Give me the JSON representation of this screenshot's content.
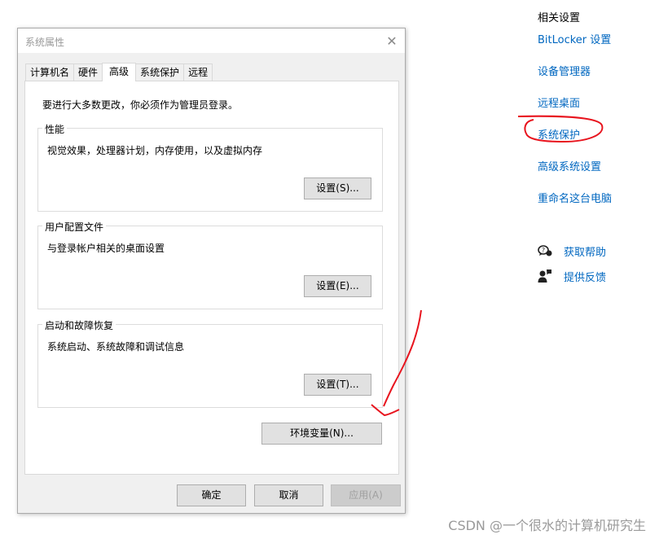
{
  "dialog": {
    "title": "系统属性",
    "tabs": [
      {
        "label": "计算机名",
        "active": false
      },
      {
        "label": "硬件",
        "active": false
      },
      {
        "label": "高级",
        "active": true
      },
      {
        "label": "系统保护",
        "active": false
      },
      {
        "label": "远程",
        "active": false
      }
    ],
    "intro": "要进行大多数更改，你必须作为管理员登录。",
    "groups": {
      "performance": {
        "title": "性能",
        "description": "视觉效果，处理器计划，内存使用，以及虚拟内存",
        "button": "设置(S)..."
      },
      "user_profiles": {
        "title": "用户配置文件",
        "description": "与登录帐户相关的桌面设置",
        "button": "设置(E)..."
      },
      "startup_recovery": {
        "title": "启动和故障恢复",
        "description": "系统启动、系统故障和调试信息",
        "button": "设置(T)..."
      }
    },
    "env_button": "环境变量(N)...",
    "footer": {
      "ok": "确定",
      "cancel": "取消",
      "apply": "应用(A)"
    }
  },
  "related": {
    "title": "相关设置",
    "links": [
      "BitLocker 设置",
      "设备管理器",
      "远程桌面",
      "系统保护",
      "高级系统设置",
      "重命名这台电脑"
    ],
    "help": {
      "get_help": "获取帮助",
      "feedback": "提供反馈"
    }
  },
  "annotation": {
    "color": "#e8141e"
  },
  "watermark": "CSDN @一个很水的计算机研究生"
}
